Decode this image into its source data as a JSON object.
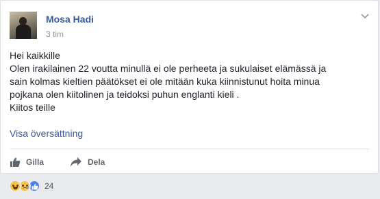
{
  "post": {
    "author_name": "Mosa Hadi",
    "timestamp": "3 tim",
    "text_lines": [
      "Hei kaikkille",
      "Olen irakilainen 22 voutta minullä ei ole perheeta ja sukulaiset elämässä ja",
      "sain kolmas kieltien päätökset ei ole mitään kuka kiinnistunut hoita minua",
      "pojkana olen kiitolinen ja teidoksi puhun englanti kieli .",
      "Kiitos teille"
    ],
    "translate_link": "Visa översättning"
  },
  "actions": {
    "like_label": "Gilla",
    "share_label": "Dela"
  },
  "reactions": {
    "icons": [
      "haha-icon",
      "sad-icon",
      "like-icon"
    ],
    "count": "24"
  },
  "colors": {
    "link_blue": "#365899",
    "text": "#1d2129",
    "meta_gray": "#90949c",
    "like_blue": "#4a7ffb",
    "reaction_yellow": "#f7c53f",
    "background": "#e9ebee"
  }
}
